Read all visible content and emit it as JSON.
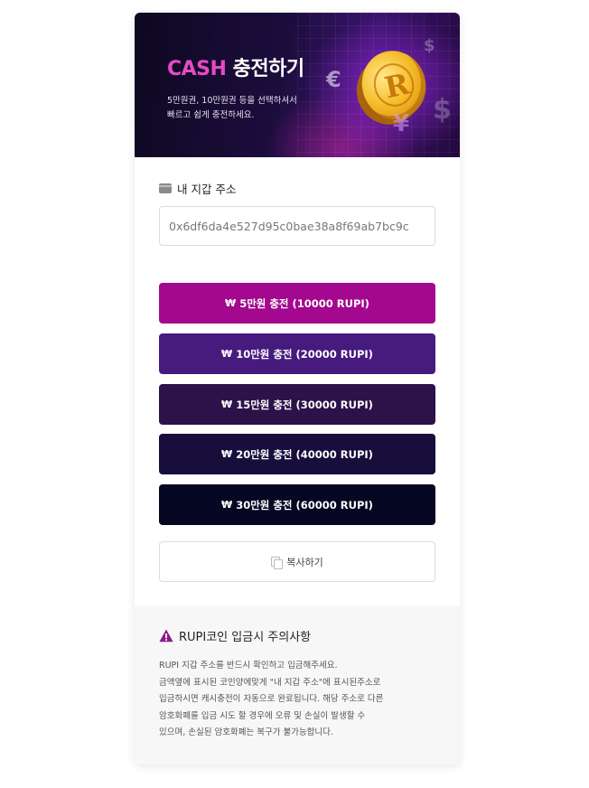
{
  "banner": {
    "title_accent": "CASH",
    "title_rest": " 충전하기",
    "desc_line1": "5만원권, 10만원권 등을 선택하셔서",
    "desc_line2": "빠르고 쉽게 충전하세요.",
    "coin_letter": "R"
  },
  "wallet": {
    "label": "내 지갑 주소",
    "value": "0x6df6da4e527d95c0bae38a8f69ab7bc9c"
  },
  "charge_buttons": [
    {
      "icon": "₩",
      "label": "5만원 충전 (10000 RUPI)",
      "color": "#a3088f"
    },
    {
      "icon": "₩",
      "label": "10만원 충전 (20000 RUPI)",
      "color": "#471b7e"
    },
    {
      "icon": "₩",
      "label": "15만원 충전 (30000 RUPI)",
      "color": "#2d1249"
    },
    {
      "icon": "₩",
      "label": "20만원 충전 (40000 RUPI)",
      "color": "#180e3c"
    },
    {
      "icon": "₩",
      "label": "30만원 충전 (60000 RUPI)",
      "color": "#060722"
    }
  ],
  "copy_button": {
    "label": "복사하기"
  },
  "notice": {
    "title": "RUPI코인 입금시 주의사항",
    "lines": [
      "RUPI 지갑 주소를 반드시 확인하고 입금해주세요.",
      "금액옆에 표시된 코인양에맞게 \"내 지갑 주소\"에 표시된주소로",
      "입금하시면 캐시충전이 자동으로 완료됩니다. 해당 주소로 다른",
      "암호화폐를 입금 시도 할 경우에 오류 및 손실이 발생할 수",
      "있으며, 손실된 암호화폐는 복구가 불가능합니다."
    ],
    "accent_color": "#8b1a87"
  }
}
